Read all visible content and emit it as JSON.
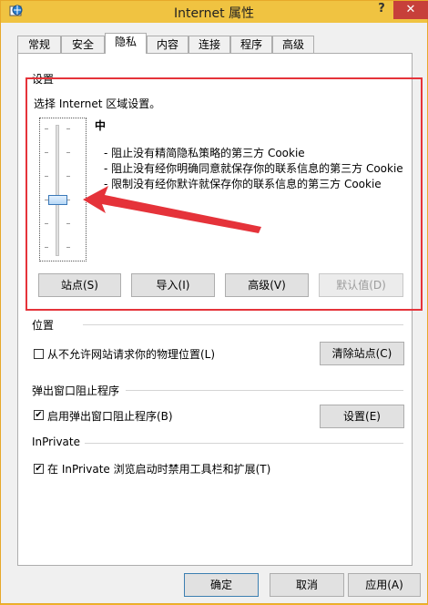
{
  "window": {
    "title": "Internet 属性",
    "help_label": "?",
    "close_label": "✕"
  },
  "tabs": [
    {
      "label": "常规"
    },
    {
      "label": "安全"
    },
    {
      "label": "隐私"
    },
    {
      "label": "内容"
    },
    {
      "label": "连接"
    },
    {
      "label": "程序"
    },
    {
      "label": "高级"
    }
  ],
  "settings": {
    "group_label": "设置",
    "prompt": "选择 Internet 区域设置。",
    "level": "中",
    "rules": [
      "- 阻止没有精简隐私策略的第三方 Cookie",
      "- 阻止没有经你明确同意就保存你的联系信息的第三方 Cookie",
      "- 限制没有经你默许就保存你的联系信息的第三方 Cookie"
    ],
    "buttons": {
      "sites": "站点(S)",
      "import": "导入(I)",
      "advanced": "高级(V)",
      "default": "默认值(D)"
    }
  },
  "location": {
    "group_label": "位置",
    "checkbox_label": "从不允许网站请求你的物理位置(L)",
    "checked": false,
    "clear_sites": "清除站点(C)"
  },
  "popup": {
    "group_label": "弹出窗口阻止程序",
    "checkbox_label": "启用弹出窗口阻止程序(B)",
    "checked": true,
    "settings_button": "设置(E)"
  },
  "inprivate": {
    "group_label": "InPrivate",
    "checkbox_label": "在 InPrivate 浏览启动时禁用工具栏和扩展(T)",
    "checked": true
  },
  "footer": {
    "ok": "确定",
    "cancel": "取消",
    "apply": "应用(A)"
  },
  "colors": {
    "titlebar": "#f0c341",
    "highlight": "#e5333a",
    "close": "#c7403a"
  }
}
